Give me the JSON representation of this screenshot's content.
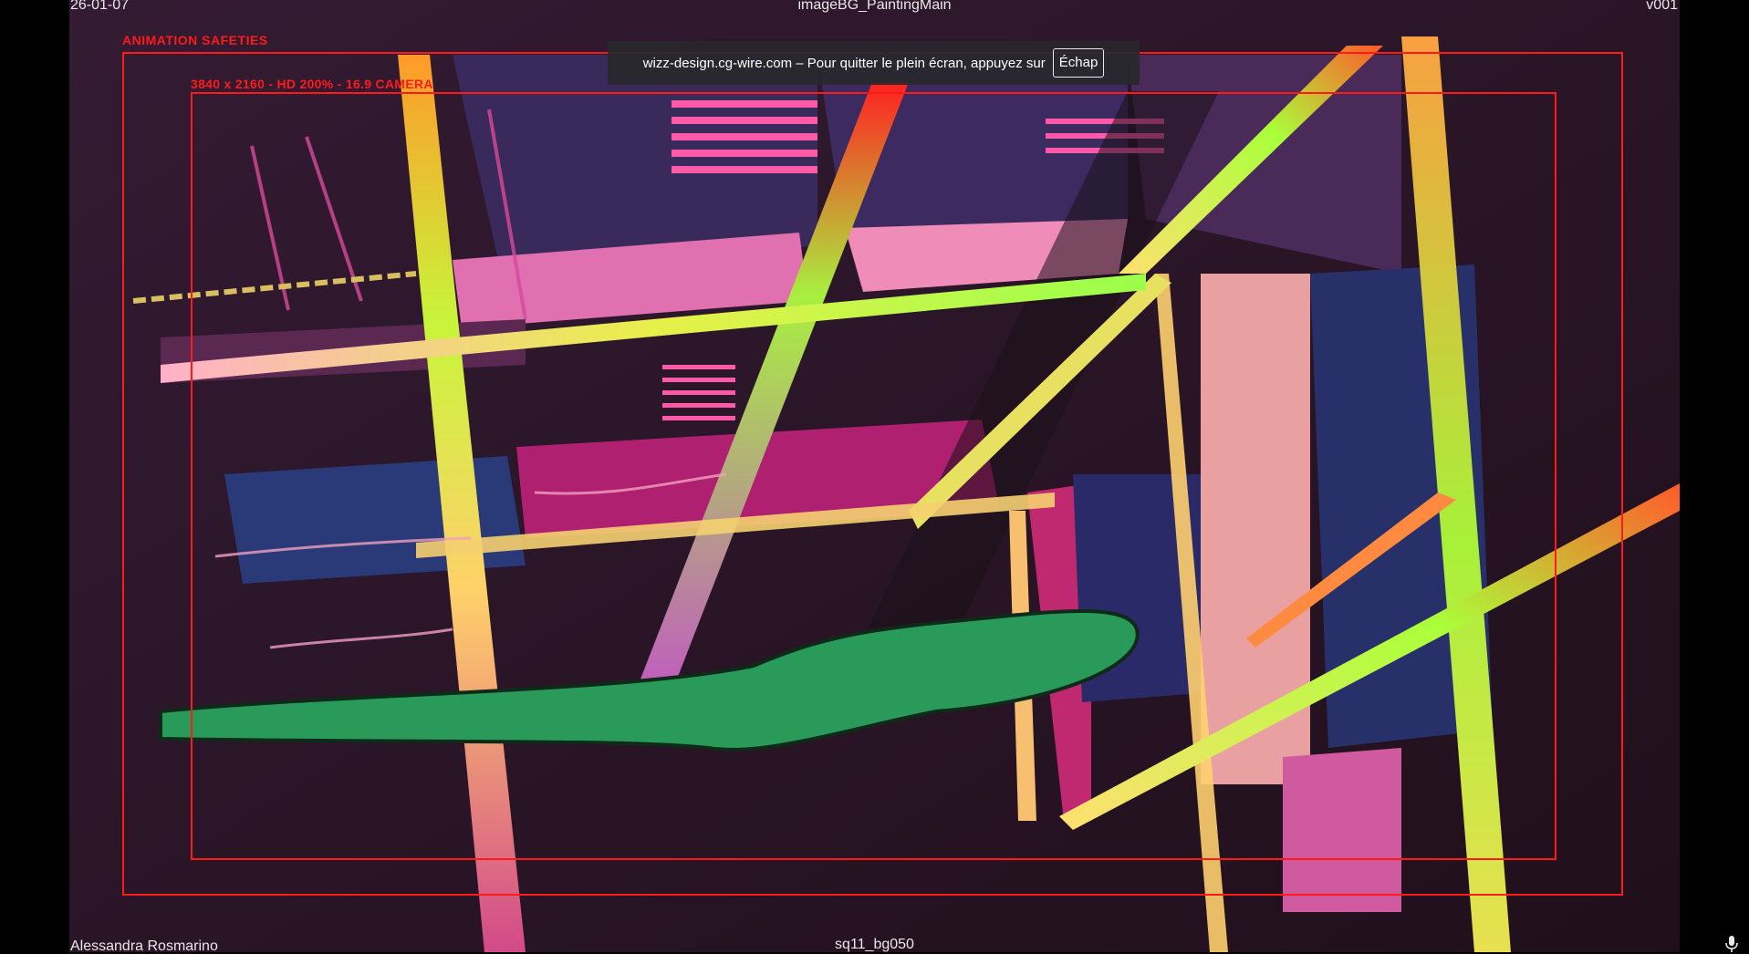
{
  "viewer": {
    "date": "26-01-07",
    "file_name": "imageBG_PaintingMain",
    "version": "v001",
    "artist": "Alessandra Rosmarino",
    "shot": "sq11_bg050"
  },
  "overlays": {
    "safety_label": "ANIMATION SAFETIES",
    "camera_label": "3840 x 2160 - HD 200% - 16.9 CAMERA",
    "frame_color": "#ff1a1a"
  },
  "fullscreen_banner": {
    "message": "wizz-design.cg-wire.com – Pour quitter le plein écran, appuyez sur",
    "key_label": "Échap"
  },
  "icons": {
    "mic": "microphone-icon"
  }
}
